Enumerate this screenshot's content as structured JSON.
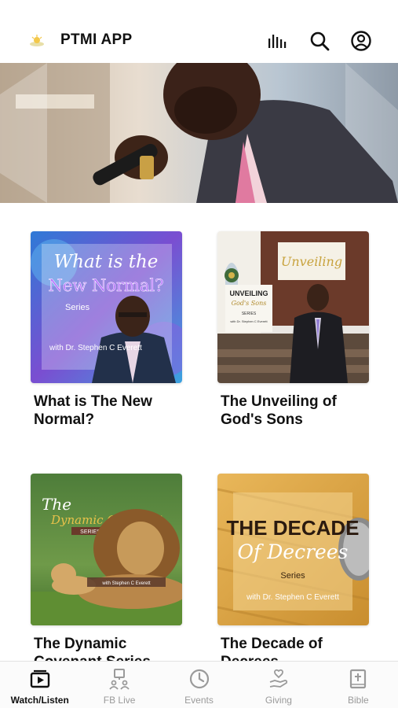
{
  "header": {
    "title": "PTMI APP"
  },
  "cards": [
    {
      "title": "What is The New Normal?",
      "art_line1": "What is the",
      "art_line2": "New Normal?",
      "art_line3": "Series",
      "art_line4": "with Dr. Stephen C Everett"
    },
    {
      "title": "The Unveiling of God's Sons",
      "art_banner": "Unveiling",
      "art_sign1": "UNVEILING",
      "art_sign2": "God's Sons",
      "art_sign3": "SERIES",
      "art_sign4": "with Dr. Stephen C Everett"
    },
    {
      "title": "The Dynamic Covenant Series",
      "art_line1": "The",
      "art_line2": "Dynamic Covenant",
      "art_line3": "SERIES",
      "art_line4": "with Stephen C Everett"
    },
    {
      "title": "The Decade of Decrees",
      "art_line1": "THE DECADE",
      "art_line2": "Of Decrees",
      "art_line3": "Series",
      "art_line4": "with Dr. Stephen C Everett"
    }
  ],
  "nav": [
    {
      "label": "Watch/Listen",
      "icon": "video-player-icon",
      "active": true
    },
    {
      "label": "FB Live",
      "icon": "live-broadcast-icon",
      "active": false
    },
    {
      "label": "Events",
      "icon": "clock-icon",
      "active": false
    },
    {
      "label": "Giving",
      "icon": "giving-hand-icon",
      "active": false
    },
    {
      "label": "Bible",
      "icon": "bible-icon",
      "active": false
    }
  ],
  "colors": {
    "active": "#111111",
    "inactive": "#9a9a9a"
  }
}
